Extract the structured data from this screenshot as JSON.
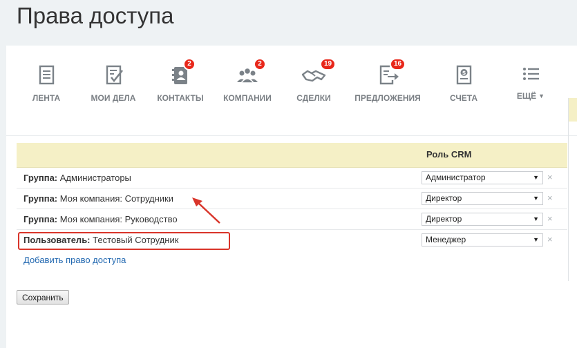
{
  "page": {
    "title": "Права доступа"
  },
  "toolbar": {
    "items": [
      {
        "label": "ЛЕНТА",
        "icon": "feed-icon",
        "badge": ""
      },
      {
        "label": "МОИ ДЕЛА",
        "icon": "tasks-icon",
        "badge": ""
      },
      {
        "label": "КОНТАКТЫ",
        "icon": "contacts-icon",
        "badge": "2"
      },
      {
        "label": "КОМПАНИИ",
        "icon": "companies-icon",
        "badge": "2"
      },
      {
        "label": "СДЕЛКИ",
        "icon": "deals-icon",
        "badge": "19"
      },
      {
        "label": "ПРЕДЛОЖЕНИЯ",
        "icon": "quotes-icon",
        "badge": "16"
      },
      {
        "label": "СЧЕТА",
        "icon": "invoices-icon",
        "badge": ""
      },
      {
        "label": "ЕЩЁ",
        "icon": "more-icon",
        "badge": ""
      }
    ]
  },
  "table": {
    "column_role": "Роль CRM",
    "rows": [
      {
        "type_label": "Группа:",
        "name": "Администраторы",
        "role": "Администратор"
      },
      {
        "type_label": "Группа:",
        "name": "Моя компания: Сотрудники",
        "role": "Директор"
      },
      {
        "type_label": "Группа:",
        "name": "Моя компания: Руководство",
        "role": "Директор"
      },
      {
        "type_label": "Пользователь:",
        "name": "Тестовый Сотрудник",
        "role": "Менеджер"
      }
    ],
    "delete_glyph": "×",
    "select_arrow": "▼"
  },
  "actions": {
    "add_link": "Добавить право доступа",
    "save_label": "Сохранить"
  },
  "colors": {
    "header_bg": "#f5f0c6",
    "badge": "#e8271a",
    "link": "#2067b0",
    "highlight": "#d9352a"
  }
}
